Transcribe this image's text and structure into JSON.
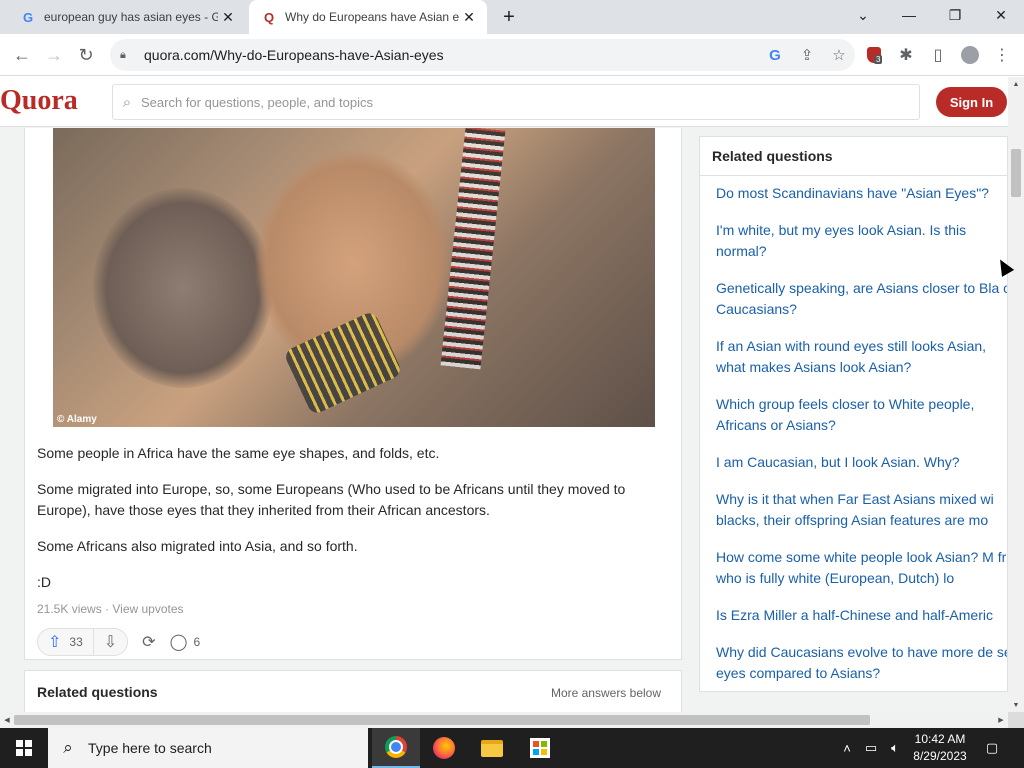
{
  "browser": {
    "tabs": [
      {
        "title": "european guy has asian eyes - Go",
        "favicon": "google-icon",
        "active": false
      },
      {
        "title": "Why do Europeans have Asian ey",
        "favicon": "quora-icon",
        "active": true
      }
    ],
    "url": "quora.com/Why-do-Europeans-have-Asian-eyes",
    "extension_badge": "3"
  },
  "quora": {
    "logo": "Quora",
    "search_placeholder": "Search for questions, people, and topics",
    "sign_in_label": "Sign In",
    "photo_credit": "© Alamy",
    "answer_paragraphs": [
      "Some people in Africa have the same eye shapes, and folds, etc.",
      "Some migrated into Europe, so, some Europeans (Who used to be Africans until they moved to Europe), have those eyes that they inherited from their African ancestors.",
      "Some Africans also migrated into Asia, and so forth.",
      ":D"
    ],
    "meta": "21.5K views · View upvotes",
    "upvotes": "33",
    "comments": "6",
    "related_bottom_title": "Related questions",
    "more_answers_label": "More answers below",
    "sidebar": {
      "title": "Related questions",
      "items": [
        "Do most Scandinavians have \"Asian Eyes\"?",
        "I'm white, but my eyes look Asian. Is this normal?",
        "Genetically speaking, are Asians closer to Bla or Caucasians?",
        "If an Asian with round eyes still looks Asian, what makes Asians look Asian?",
        "Which group feels closer to White people, Africans or Asians?",
        "I am Caucasian, but I look Asian. Why?",
        "Why is it that when Far East Asians mixed wi blacks, their offspring Asian features are mo",
        "How come some white people look Asian? M friend who is fully white (European, Dutch) lo",
        "Is Ezra Miller a half-Chinese and half-Americ",
        "Why did Caucasians evolve to have more de set eyes compared to Asians?"
      ]
    }
  },
  "taskbar": {
    "search_placeholder": "Type here to search",
    "time": "10:42 AM",
    "date": "8/29/2023"
  },
  "colors": {
    "quora_red": "#b92b27",
    "link_blue": "#195faa",
    "upvote_blue": "#2e69ff"
  }
}
